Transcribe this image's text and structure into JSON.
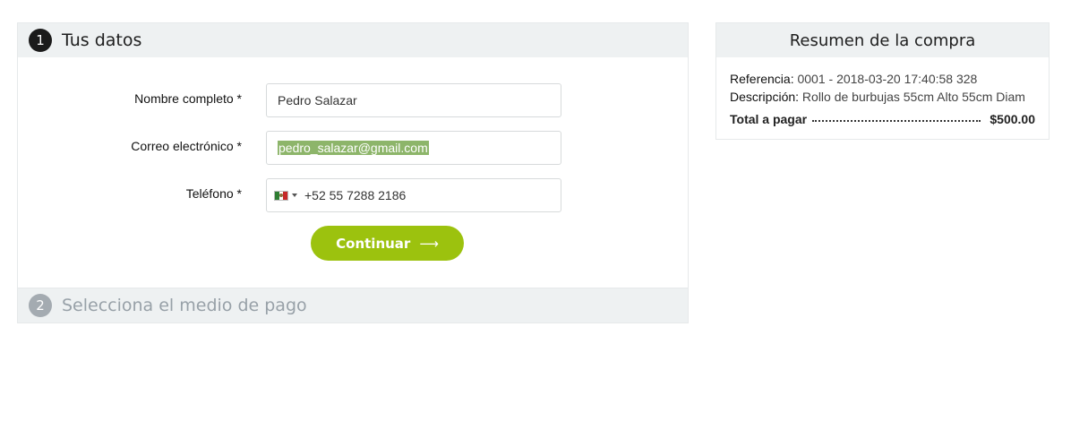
{
  "step1": {
    "number": "1",
    "title": "Tus datos",
    "fields": {
      "name_label": "Nombre completo *",
      "name_value": "Pedro Salazar",
      "email_label": "Correo electrónico *",
      "email_value": "pedro_salazar@gmail.com",
      "phone_label": "Teléfono *",
      "phone_value": "+52 55 7288 2186",
      "phone_country_icon": "mexico-flag-icon"
    },
    "continue_label": "Continuar",
    "continue_arrow": "⟶"
  },
  "step2": {
    "number": "2",
    "title": "Selecciona el medio de pago"
  },
  "summary": {
    "title": "Resumen de la compra",
    "reference_label": "Referencia:",
    "reference_value": "0001 - 2018-03-20 17:40:58 328",
    "description_label": "Descripción:",
    "description_value": "Rollo de burbujas 55cm Alto 55cm Diam",
    "total_label": "Total a pagar",
    "total_value": "$500.00"
  },
  "colors": {
    "accent": "#9cc20e",
    "header_bg": "#eef1f2",
    "selection": "#8db56a"
  }
}
